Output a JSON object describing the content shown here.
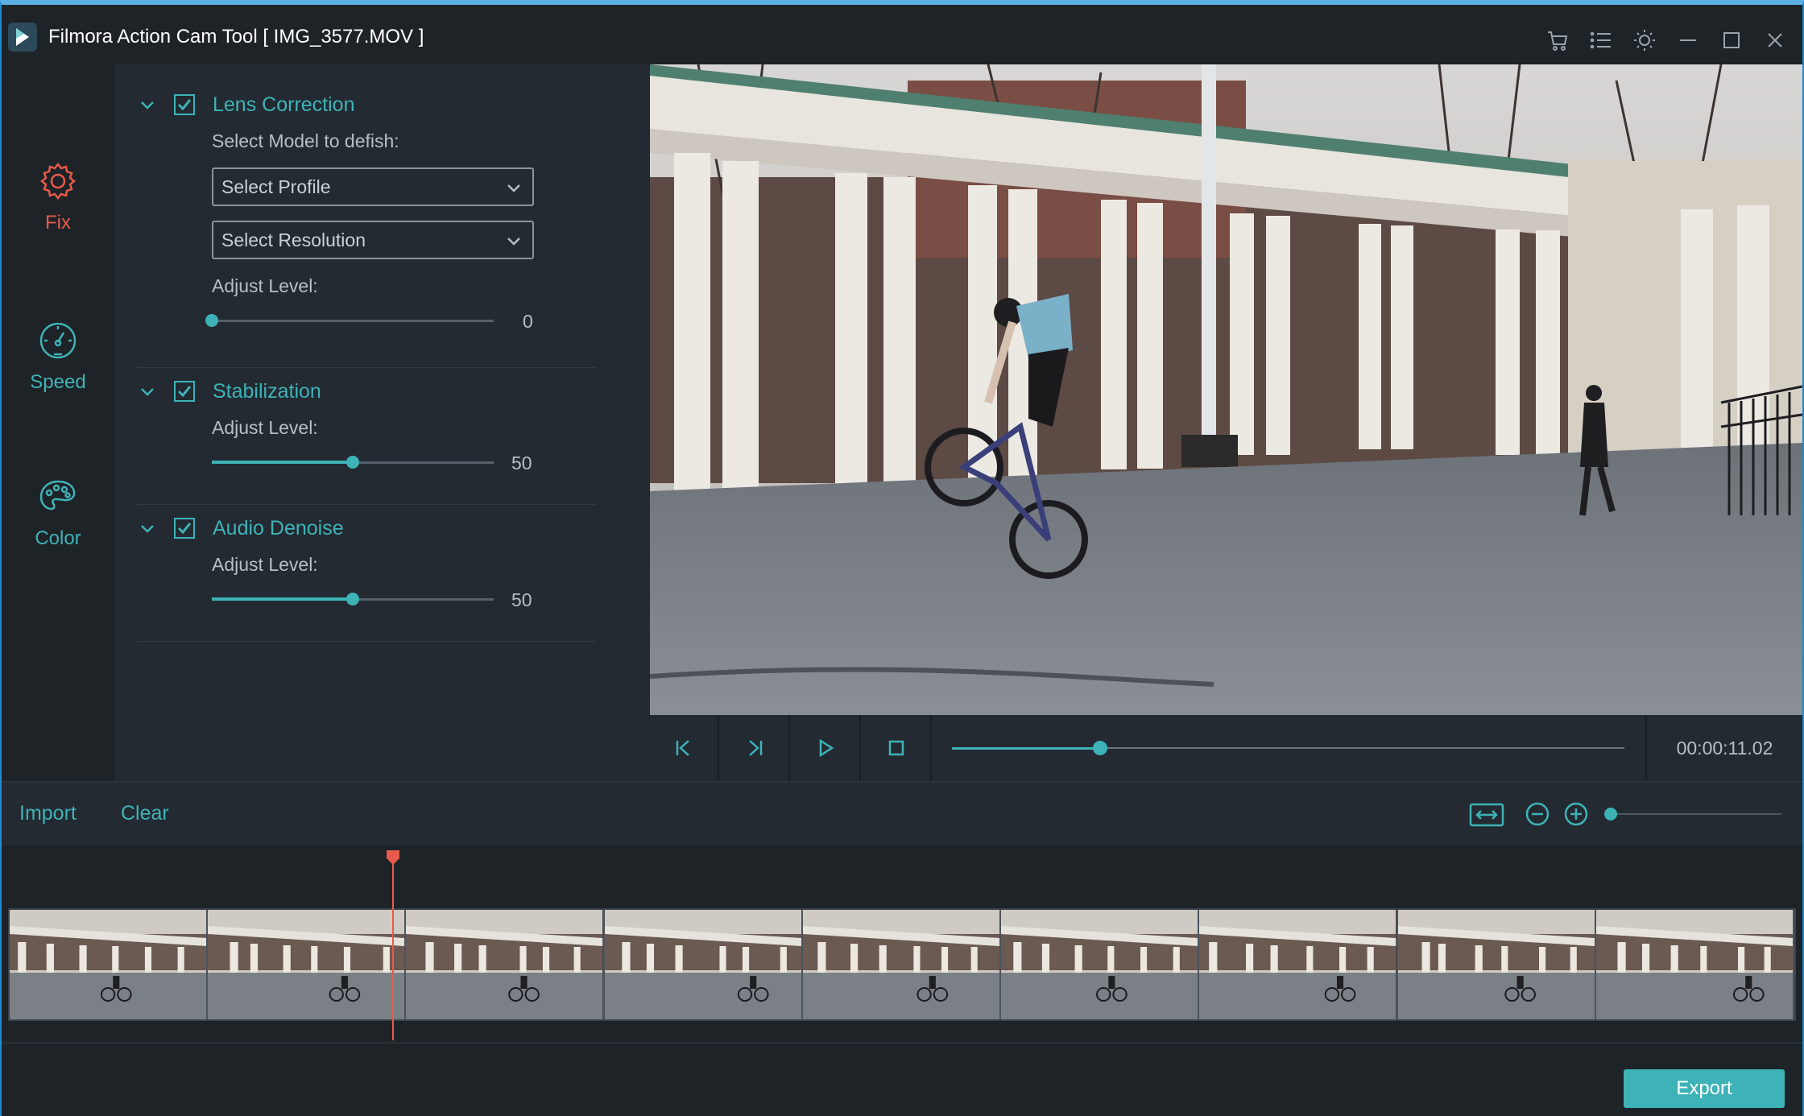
{
  "window": {
    "title": "Filmora Action Cam Tool  [ IMG_3577.MOV ]",
    "accent": "#3eb3b7",
    "active_color": "#e85a4a",
    "titlebar_icons": [
      "cart-icon",
      "list-icon",
      "brightness-icon",
      "minimize-icon",
      "maximize-icon",
      "close-icon"
    ]
  },
  "rail": {
    "items": [
      {
        "label": "Fix",
        "icon": "gear-icon",
        "active": true
      },
      {
        "label": "Speed",
        "icon": "speedometer-icon",
        "active": false
      },
      {
        "label": "Color",
        "icon": "palette-icon",
        "active": false
      }
    ]
  },
  "fix_panel": {
    "lens_correction": {
      "title": "Lens Correction",
      "checked": true,
      "model_label": "Select Model to defish:",
      "profile_select": "Select Profile",
      "resolution_select": "Select Resolution",
      "adjust_label": "Adjust Level:",
      "value": "0",
      "value_fraction": 0.0
    },
    "stabilization": {
      "title": "Stabilization",
      "checked": true,
      "adjust_label": "Adjust Level:",
      "value": "50",
      "value_fraction": 0.5
    },
    "audio_denoise": {
      "title": "Audio Denoise",
      "checked": true,
      "adjust_label": "Adjust Level:",
      "value": "50",
      "value_fraction": 0.5
    }
  },
  "transport": {
    "buttons": [
      "skip-to-start-icon",
      "next-frame-icon",
      "play-icon",
      "stop-icon"
    ],
    "timecode": "00:00:11.02",
    "progress_fraction": 0.22
  },
  "timeline_toolbar": {
    "import_label": "Import",
    "clear_label": "Clear",
    "tools": [
      "fit-timeline-icon",
      "zoom-out-icon",
      "zoom-in-icon"
    ],
    "zoom_fraction": 0.0
  },
  "timeline": {
    "thumbnail_count": 9,
    "playhead_fraction": 0.215
  },
  "footer": {
    "export_label": "Export"
  }
}
